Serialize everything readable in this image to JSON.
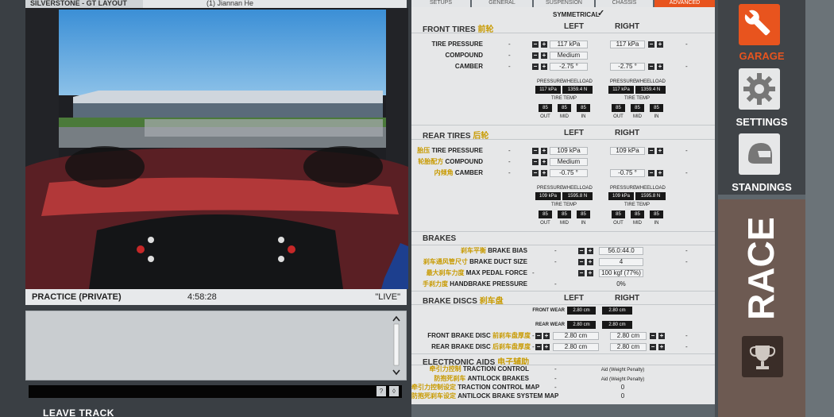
{
  "top_bar": {
    "location": "SILVERSTONE - GT LAYOUT",
    "driver": "(1) Jiannan He"
  },
  "session": {
    "name": "PRACTICE (PRIVATE)",
    "time": "4:58:28",
    "status": "\"LIVE\""
  },
  "leave_track": "LEAVE TRACK",
  "tabs": [
    "SETUPS",
    "GENERAL",
    "SUSPENSION",
    "CHASSIS",
    "ADVANCED"
  ],
  "symmetrical": {
    "label": "SYMMETRICAL",
    "check": "✓"
  },
  "front_tires": {
    "title": "FRONT TIRES",
    "title_cn": "前轮",
    "left": "LEFT",
    "right": "RIGHT",
    "rows": [
      {
        "label": "TIRE PRESSURE",
        "dash": "-",
        "left": "117 kPa",
        "right": "117 kPa",
        "dash2": "-"
      },
      {
        "label": "COMPOUND",
        "dash": "-",
        "left": "Medium",
        "right": "",
        "dash2": ""
      },
      {
        "label": "CAMBER",
        "dash": "-",
        "left": "-2.75 °",
        "right": "-2.75 °",
        "dash2": "-"
      }
    ],
    "telemetry": {
      "left": {
        "pressure_label": "PRESSURE",
        "pressure": "117 kPa",
        "wheelload_label": "WHEELLOAD",
        "wheelload": "1359.4 N",
        "temp_label": "TIRE TEMP",
        "temps": [
          "85",
          "85",
          "85"
        ]
      },
      "right": {
        "pressure_label": "PRESSURE",
        "pressure": "117 kPa",
        "wheelload_label": "WHEELLOAD",
        "wheelload": "1359.4 N",
        "temp_label": "TIRE TEMP",
        "temps": [
          "85",
          "85",
          "85"
        ]
      },
      "zones": [
        "OUT",
        "MID",
        "IN"
      ]
    }
  },
  "rear_tires": {
    "title": "REAR TIRES",
    "title_cn": "后轮",
    "left": "LEFT",
    "right": "RIGHT",
    "rows": [
      {
        "label_cn": "胎压",
        "label": "TIRE PRESSURE",
        "dash": "-",
        "left": "109 kPa",
        "right": "109 kPa",
        "dash2": "-"
      },
      {
        "label_cn": "轮胎配方",
        "label": "COMPOUND",
        "dash": "-",
        "left": "Medium",
        "right": "",
        "dash2": ""
      },
      {
        "label_cn": "内倾角",
        "label": "CAMBER",
        "dash": "-",
        "left": "-0.75 °",
        "right": "-0.75 °",
        "dash2": "-"
      }
    ],
    "telemetry": {
      "left": {
        "pressure_label": "PRESSURE",
        "pressure": "109 kPa",
        "wheelload_label": "WHEELLOAD",
        "wheelload": "1595.8 N",
        "temp_label": "TIRE TEMP",
        "temps": [
          "85",
          "85",
          "85"
        ]
      },
      "right": {
        "pressure_label": "PRESSURE",
        "pressure": "109 kPa",
        "wheelload_label": "WHEELLOAD",
        "wheelload": "1595.8 N",
        "temp_label": "TIRE TEMP",
        "temps": [
          "85",
          "85",
          "85"
        ]
      },
      "zones": [
        "OUT",
        "MID",
        "IN"
      ]
    }
  },
  "brakes": {
    "title": "BRAKES",
    "rows": [
      {
        "label_cn": "刹车平衡",
        "label": "BRAKE BIAS",
        "dash": "-",
        "value": "56.0:44.0",
        "dash2": "-"
      },
      {
        "label_cn": "刹车通风管尺寸",
        "label": "BRAKE DUCT SIZE",
        "dash": "-",
        "value": "4",
        "dash2": "-"
      },
      {
        "label_cn": "最大刹车力度",
        "label": "MAX PEDAL FORCE",
        "dash": "-",
        "value": "100 kgf (77%)",
        "dash2": ""
      },
      {
        "label_cn": "手刹力度",
        "label": "HANDBRAKE PRESSURE",
        "dash": "-",
        "value": "0%",
        "dash2": ""
      }
    ]
  },
  "brake_discs": {
    "title": "BRAKE DISCS",
    "title_cn": "刹车盘",
    "left": "LEFT",
    "right": "RIGHT",
    "wear": [
      {
        "label": "FRONT WEAR",
        "left": "2.80 cm",
        "right": "2.80 cm"
      },
      {
        "label": "REAR WEAR",
        "left": "2.80 cm",
        "right": "2.80 cm"
      }
    ],
    "rows": [
      {
        "label": "FRONT BRAKE DISC",
        "label_cn": "前刹车盘厚度",
        "dash": "-",
        "left": "2.80 cm",
        "right": "2.80 cm",
        "dash2": "-"
      },
      {
        "label": "REAR BRAKE DISC",
        "label_cn": "后刹车盘厚度",
        "dash": "-",
        "left": "2.80 cm",
        "right": "2.80 cm",
        "dash2": "-"
      }
    ]
  },
  "electronic_aids": {
    "title": "ELECTRONIC AIDS",
    "title_cn": "电子辅助",
    "rows": [
      {
        "label_cn": "牵引力控制",
        "label": "TRACTION CONTROL",
        "dash": "-",
        "value": "Aid (Weight Penalty)"
      },
      {
        "label_cn": "防抱死刹车",
        "label": "ANTILOCK BRAKES",
        "dash": "-",
        "value": "Aid (Weight Penalty)"
      },
      {
        "label_cn": "牵引力控制设定",
        "label": "TRACTION CONTROL MAP",
        "dash": "-",
        "value": "0"
      },
      {
        "label_cn": "防抱死刹车设定",
        "label": "ANTILOCK BRAKE SYSTEM MAP",
        "dash": "-",
        "value": "0"
      }
    ]
  },
  "buttons": {
    "minus": "−",
    "plus": "+"
  },
  "nav": {
    "garage": "GARAGE",
    "settings": "SETTINGS",
    "standings": "STANDINGS",
    "race": "RACE"
  },
  "colors": {
    "accent": "#e8541e",
    "dark_panel": "#404448",
    "setup_bg": "#e6e7e8"
  }
}
